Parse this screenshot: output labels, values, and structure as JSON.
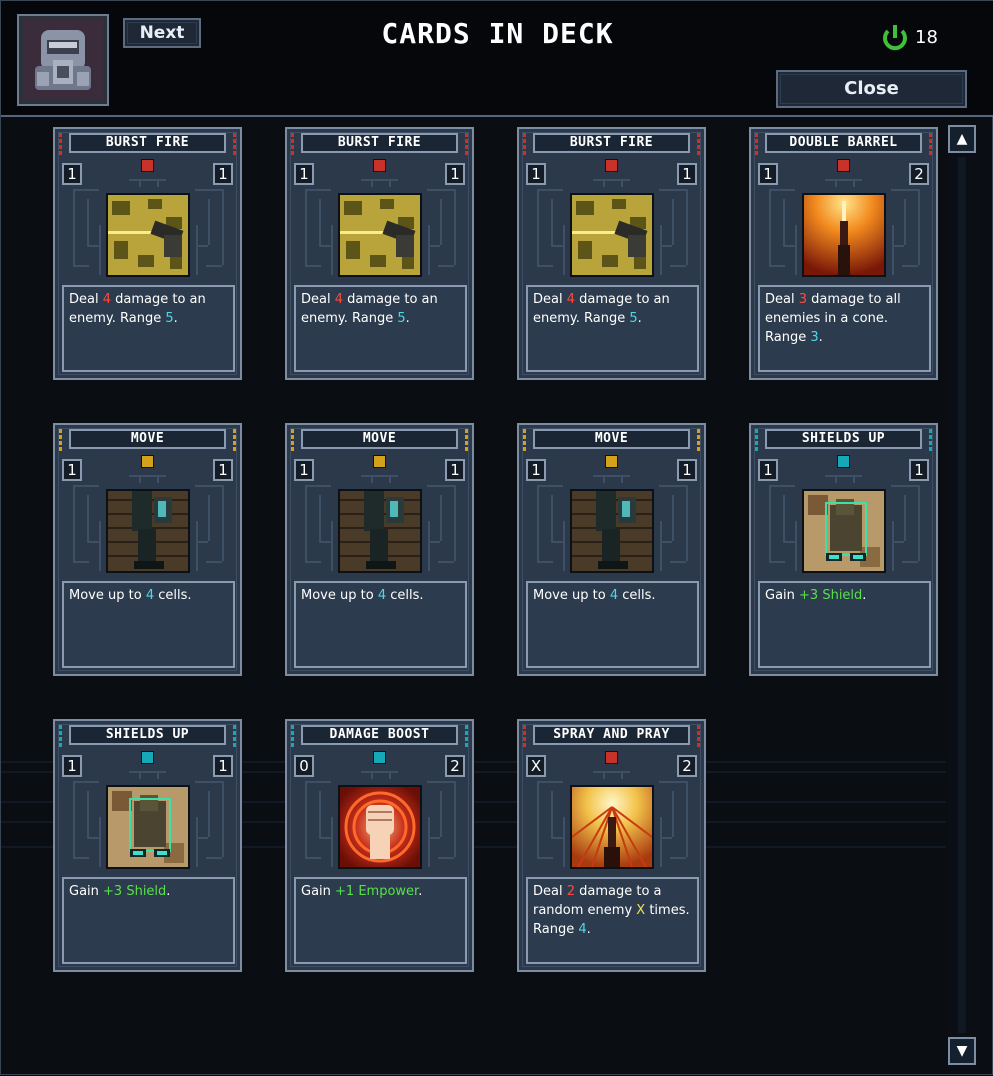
{
  "header": {
    "title": "CARDS IN DECK",
    "next_label": "Next",
    "close_label": "Close",
    "energy_count": "18",
    "energy_icon": "power-icon",
    "portrait_icon": "helmet-portrait-icon"
  },
  "scrollbar": {
    "up_icon": "arrow-up-icon",
    "down_icon": "arrow-down-icon"
  },
  "colors": {
    "red": "#c8322a",
    "yellow": "#d3a21c",
    "teal": "#17a8b8",
    "damage": "#ff4a3d",
    "range": "#4fd8e6",
    "gain": "#57e04a",
    "variable": "#f1e14a"
  },
  "cards": [
    {
      "name": "BURST FIRE",
      "cost": "1",
      "copies": "1",
      "color": "red",
      "art": "gunfire",
      "desc": [
        {
          "t": "Deal "
        },
        {
          "t": "4",
          "c": "red"
        },
        {
          "t": " damage to an enemy. Range "
        },
        {
          "t": "5",
          "c": "cyan"
        },
        {
          "t": "."
        }
      ]
    },
    {
      "name": "BURST FIRE",
      "cost": "1",
      "copies": "1",
      "color": "red",
      "art": "gunfire",
      "desc": [
        {
          "t": "Deal "
        },
        {
          "t": "4",
          "c": "red"
        },
        {
          "t": " damage to an enemy. Range "
        },
        {
          "t": "5",
          "c": "cyan"
        },
        {
          "t": "."
        }
      ]
    },
    {
      "name": "BURST FIRE",
      "cost": "1",
      "copies": "1",
      "color": "red",
      "art": "gunfire",
      "desc": [
        {
          "t": "Deal "
        },
        {
          "t": "4",
          "c": "red"
        },
        {
          "t": " damage to an enemy. Range "
        },
        {
          "t": "5",
          "c": "cyan"
        },
        {
          "t": "."
        }
      ]
    },
    {
      "name": "DOUBLE BARREL",
      "cost": "1",
      "copies": "2",
      "color": "red",
      "art": "flame",
      "desc": [
        {
          "t": "Deal "
        },
        {
          "t": "3",
          "c": "red"
        },
        {
          "t": " damage to all enemies in a cone. Range "
        },
        {
          "t": "3",
          "c": "cyan"
        },
        {
          "t": "."
        }
      ]
    },
    {
      "name": "MOVE",
      "cost": "1",
      "copies": "1",
      "color": "yellow",
      "art": "legs",
      "desc": [
        {
          "t": "Move up to "
        },
        {
          "t": "4",
          "c": "cyan"
        },
        {
          "t": " cells."
        }
      ]
    },
    {
      "name": "MOVE",
      "cost": "1",
      "copies": "1",
      "color": "yellow",
      "art": "legs",
      "desc": [
        {
          "t": "Move up to "
        },
        {
          "t": "4",
          "c": "cyan"
        },
        {
          "t": " cells."
        }
      ]
    },
    {
      "name": "MOVE",
      "cost": "1",
      "copies": "1",
      "color": "yellow",
      "art": "legs",
      "desc": [
        {
          "t": "Move up to "
        },
        {
          "t": "4",
          "c": "cyan"
        },
        {
          "t": " cells."
        }
      ]
    },
    {
      "name": "SHIELDS UP",
      "cost": "1",
      "copies": "1",
      "color": "teal",
      "art": "shield",
      "desc": [
        {
          "t": "Gain "
        },
        {
          "t": "+3 Shield",
          "c": "green"
        },
        {
          "t": "."
        }
      ]
    },
    {
      "name": "SHIELDS UP",
      "cost": "1",
      "copies": "1",
      "color": "teal",
      "art": "shield",
      "desc": [
        {
          "t": "Gain "
        },
        {
          "t": "+3 Shield",
          "c": "green"
        },
        {
          "t": "."
        }
      ]
    },
    {
      "name": "DAMAGE BOOST",
      "cost": "0",
      "copies": "2",
      "color": "teal",
      "art": "fist",
      "desc": [
        {
          "t": "Gain "
        },
        {
          "t": "+1 Empower",
          "c": "green"
        },
        {
          "t": "."
        }
      ]
    },
    {
      "name": "SPRAY AND PRAY",
      "cost": "X",
      "copies": "2",
      "color": "red",
      "art": "spray",
      "desc": [
        {
          "t": "Deal "
        },
        {
          "t": "2",
          "c": "red"
        },
        {
          "t": " damage to a random enemy "
        },
        {
          "t": "X",
          "c": "yellow"
        },
        {
          "t": " times. Range "
        },
        {
          "t": "4",
          "c": "cyan"
        },
        {
          "t": "."
        }
      ]
    }
  ]
}
